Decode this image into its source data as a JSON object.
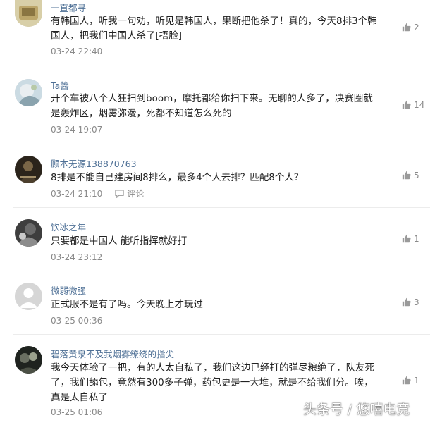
{
  "comments": [
    {
      "username": "一直都寻",
      "text": "有韩国人，听我一句劝，听见是韩国人，果断把他杀了！真的，今天8排3个韩国人，把我们中国人杀了[捂脸]",
      "time": "03-24 22:40",
      "likes": "2",
      "avatar_color": "#c7b98a"
    },
    {
      "username": "Ta醬",
      "text": "开个车被八个人狂扫到boom，摩托都给你扫下来。无聊的人多了，决赛圈就是轰炸区，烟雾弥漫，死都不知道怎么死的",
      "time": "03-24 19:07",
      "likes": "14",
      "avatar_color": "#9fb6c3"
    },
    {
      "username": "顾本无源138870763",
      "text": "8排是不能自己建房间8排么，最多4个人去排？匹配8个人？",
      "time": "03-24 21:10",
      "reply_label": "评论",
      "likes": "5",
      "avatar_color": "#3a3226"
    },
    {
      "username": "饮冰之年",
      "text": "只要都是中国人 能听指挥就好打",
      "time": "03-24 23:12",
      "likes": "1",
      "avatar_color": "#4a4a4a"
    },
    {
      "username": "微弱微强",
      "text": "正式服不是有了吗。今天晚上才玩过",
      "time": "03-25 00:36",
      "likes": "3",
      "avatar_color": "#d3d3d3"
    },
    {
      "username": "碧落黄泉不及我烟雾缭绕的指尖",
      "text": "我今天体验了一把，有的人太自私了，我们这边已经打的弹尽粮绝了，队友死了，我们舔包，竟然有300多子弹，药包更是一大堆，就是不给我们分。唉，真是太自私了",
      "time": "03-25 01:06",
      "likes": "1",
      "avatar_color": "#2c2f2b"
    }
  ],
  "watermark": "头条号 / 悠嘻电竞"
}
